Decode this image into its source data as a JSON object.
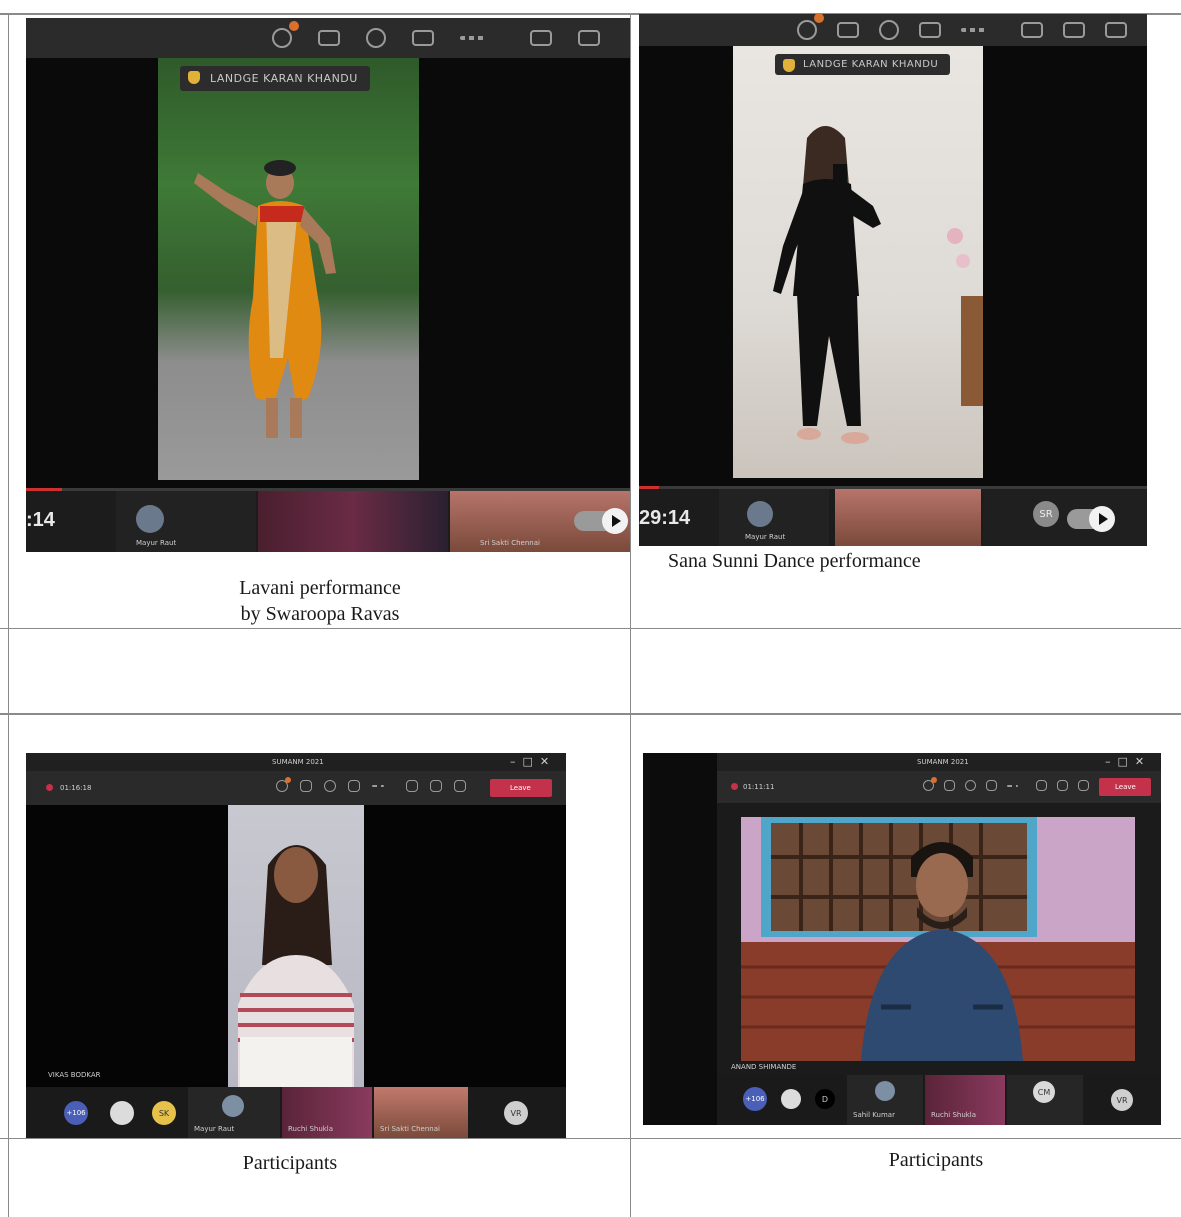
{
  "layout_table": {
    "cells": [
      {
        "id": "lavani",
        "caption_lines": [
          "Lavani performance",
          "by Swaroopa Ravas"
        ],
        "meeting": {
          "presenter_name": "LANDGE KARAN KHANDU",
          "elapsed_time": ":14",
          "progress_fraction": 0.06,
          "participants": [
            "Mayur Raut",
            "",
            "Sri Sakti Chennai"
          ]
        }
      },
      {
        "id": "sana",
        "caption_lines": [
          "Sana Sunni Dance performance"
        ],
        "meeting": {
          "presenter_name": "LANDGE KARAN KHANDU",
          "elapsed_time": "29:14",
          "progress_fraction": 0.04,
          "participants": [
            "Mayur Raut",
            "",
            "",
            "SR"
          ]
        }
      },
      {
        "id": "participants-left",
        "caption_lines": [
          "Participants"
        ],
        "meeting": {
          "window_title": "SUMANM 2021",
          "elapsed_time": "01:16:18",
          "leave_label": "Leave",
          "speaker_label": "VIKAS BODKAR",
          "participants": [
            "+106",
            "",
            "SK",
            "Mayur Raut",
            "Ruchi Shukla",
            "Sri Sakti Chennai",
            "VR"
          ]
        }
      },
      {
        "id": "participants-right",
        "caption_lines": [
          "Participants"
        ],
        "meeting": {
          "window_title": "SUMANM 2021",
          "elapsed_time": "01:11:11",
          "leave_label": "Leave",
          "speaker_label": "ANAND SHIMANDE",
          "participants": [
            "+106",
            "",
            "D",
            "Sahil Kumar",
            "Ruchi Shukla",
            "CM",
            "VR"
          ]
        }
      }
    ]
  },
  "colors": {
    "toolbar": "#2b2b2b",
    "video_bg": "#0a0a0a",
    "progress": "#d0302d",
    "leave_button": "#c4314b",
    "raised_hand": "#e2b13a",
    "badge": "#d8702e"
  }
}
